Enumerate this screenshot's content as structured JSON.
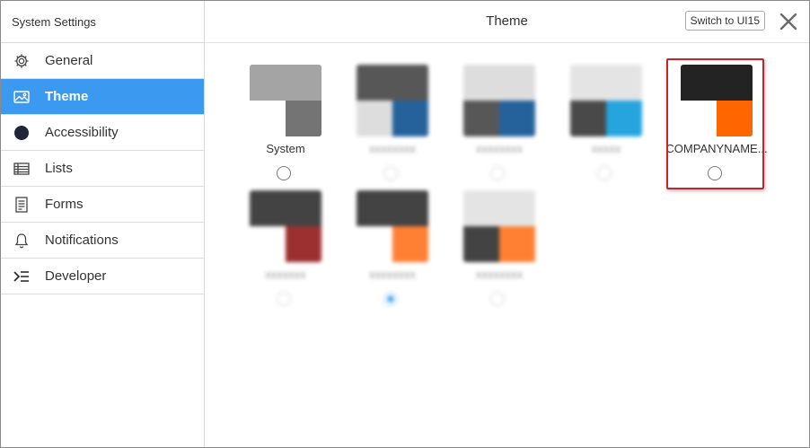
{
  "sidebar": {
    "title": "System Settings",
    "items": [
      {
        "label": "General",
        "icon": "gear-icon"
      },
      {
        "label": "Theme",
        "icon": "image-icon",
        "active": true
      },
      {
        "label": "Accessibility",
        "icon": "circle-icon"
      },
      {
        "label": "Lists",
        "icon": "list-table-icon"
      },
      {
        "label": "Forms",
        "icon": "form-document-icon"
      },
      {
        "label": "Notifications",
        "icon": "bell-icon"
      },
      {
        "label": "Developer",
        "icon": "developer-icon"
      }
    ]
  },
  "header": {
    "title": "Theme",
    "switch_label": "Switch to UI15",
    "close_icon": "close-icon"
  },
  "themes": [
    {
      "label": "System",
      "colors": {
        "top": "#a4a4a4",
        "left": "#ffffff",
        "right": "#747474"
      },
      "blurred": false,
      "selected": false
    },
    {
      "label": "xxxxxxxx",
      "colors": {
        "top": "#3a3a3a",
        "left": "#d8d8d8",
        "right": "#00478a"
      },
      "blurred": true,
      "selected": false
    },
    {
      "label": "xxxxxxxx",
      "colors": {
        "top": "#d8d8d8",
        "left": "#3a3a3a",
        "right": "#00478a"
      },
      "blurred": true,
      "selected": false
    },
    {
      "label": "xxxxx",
      "colors": {
        "top": "#e0e0e0",
        "left": "#2a2a2a",
        "right": "#0095d9"
      },
      "blurred": true,
      "selected": false
    },
    {
      "label": "COMPANYNAME...",
      "colors": {
        "top": "#232323",
        "left": "#ffffff",
        "right": "#ff6600"
      },
      "blurred": false,
      "selected": false,
      "highlighted": true
    },
    {
      "label": "xxxxxxx",
      "colors": {
        "top": "#232323",
        "left": "#ffffff",
        "right": "#8b0d0d"
      },
      "blurred": true,
      "selected": false
    },
    {
      "label": "xxxxxxxx",
      "colors": {
        "top": "#232323",
        "left": "#ffffff",
        "right": "#ff6a10"
      },
      "blurred": true,
      "selected": true
    },
    {
      "label": "xxxxxxxx",
      "colors": {
        "top": "#e0e0e0",
        "left": "#232323",
        "right": "#ff6a10"
      },
      "blurred": true,
      "selected": false
    }
  ],
  "colors": {
    "accent": "#3b99f0",
    "highlight_border": "#c8232c"
  }
}
